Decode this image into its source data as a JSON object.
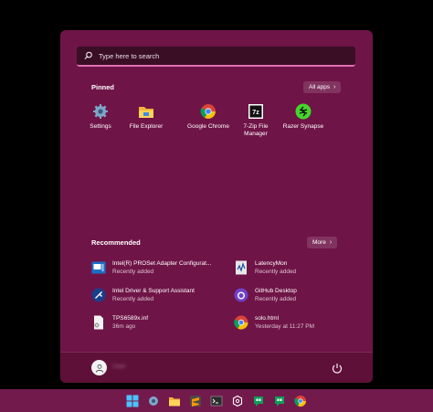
{
  "search": {
    "placeholder": "Type here to search"
  },
  "pinned": {
    "title": "Pinned",
    "all_apps_label": "All apps",
    "apps": [
      {
        "label": "Settings",
        "icon": "settings-icon"
      },
      {
        "label": "File Explorer",
        "icon": "folder-icon"
      },
      {
        "label": "Google Chrome",
        "icon": "chrome-icon"
      },
      {
        "label": "7-Zip File Manager",
        "icon": "7zip-icon"
      },
      {
        "label": "Razer Synapse",
        "icon": "razer-icon"
      }
    ]
  },
  "recommended": {
    "title": "Recommended",
    "more_label": "More",
    "items": [
      {
        "name": "Intel(R) PROSet Adapter Configurat...",
        "sub": "Recently added",
        "icon": "network-adapter-icon"
      },
      {
        "name": "LatencyMon",
        "sub": "Recently added",
        "icon": "latencymon-icon"
      },
      {
        "name": "Intel Driver & Support Assistant",
        "sub": "Recently added",
        "icon": "intel-assistant-icon"
      },
      {
        "name": "GitHub Desktop",
        "sub": "Recently added",
        "icon": "github-icon"
      },
      {
        "name": "TPS6589x.inf",
        "sub": "36m ago",
        "icon": "inf-file-icon"
      },
      {
        "name": "solo.html",
        "sub": "Yesterday at 11:27 PM",
        "icon": "chrome-file-icon"
      }
    ]
  },
  "footer": {
    "user_name": "User",
    "power_icon": "power-icon"
  },
  "taskbar": {
    "icons": [
      "windows-start-icon",
      "settings-icon",
      "file-explorer-icon",
      "sublime-icon",
      "terminal-icon",
      "chatgpt-icon",
      "hangouts-icon",
      "hangouts-icon",
      "chrome-icon"
    ]
  },
  "colors": {
    "menu_bg": "#6f1447",
    "accent": "#e06fb2",
    "taskbar_bg": "#731a4d"
  }
}
